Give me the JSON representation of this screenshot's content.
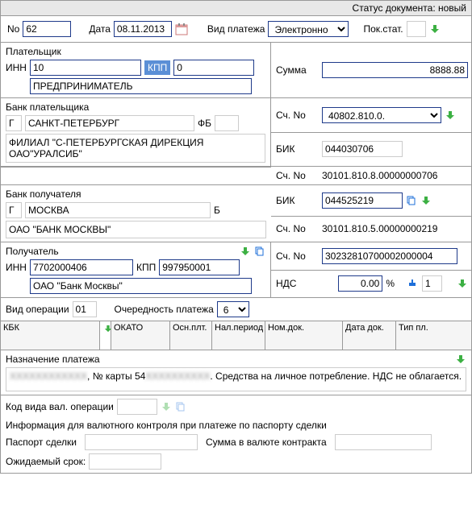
{
  "status_bar": "Статус документа: новый",
  "header": {
    "no_label": "No",
    "no_value": "62",
    "date_label": "Дата",
    "date_value": "08.11.2013",
    "payment_type_label": "Вид платежа",
    "payment_type_value": "Электронно",
    "payment_type_options": [
      "Электронно"
    ],
    "pok_stat_label": "Пок.стат."
  },
  "payer": {
    "title": "Плательщик",
    "inn_label": "ИНН",
    "inn_value": "10",
    "kpp_label": "КПП",
    "kpp_value": "0",
    "name_value": "ПРЕДПРИНИМАТЕЛЬ",
    "bank_title": "Банк плательщика",
    "city_prefix": "Г",
    "city_value": "САНКТ-ПЕТЕРБУРГ",
    "fb_label": "ФБ",
    "bank_name": "ФИЛИАЛ \"С-ПЕТЕРБУРГСКАЯ ДИРЕКЦИЯ ОАО\"УРАЛСИБ\""
  },
  "amount": {
    "label": "Сумма",
    "value": "8888.88"
  },
  "payer_acc": {
    "label": "Сч. No",
    "value": "40802.810.0."
  },
  "payer_bank_bik": {
    "label": "БИК",
    "value": "044030706"
  },
  "payer_bank_acc": {
    "label": "Сч. No",
    "value": "30101.810.8.00000000706"
  },
  "payee_bank": {
    "title": "Банк получателя",
    "city_prefix": "Г",
    "city_value": "МОСКВА",
    "b_label": "Б",
    "bank_name": "ОАО \"БАНК МОСКВЫ\""
  },
  "payee_bank_bik": {
    "label": "БИК",
    "value": "044525219"
  },
  "payee_bank_acc": {
    "label": "Сч. No",
    "value": "30101.810.5.00000000219"
  },
  "payee": {
    "title": "Получатель",
    "inn_label": "ИНН",
    "inn_value": "7702000406",
    "kpp_label": "КПП",
    "kpp_value": "997950001",
    "name_value": "ОАО \"Банк Москвы\""
  },
  "payee_acc": {
    "label": "Сч. No",
    "value": "30232810700002000004"
  },
  "nds": {
    "label": "НДС",
    "percent": "0.00",
    "percent_suffix": "%",
    "code": "1"
  },
  "op": {
    "op_type_label": "Вид операции",
    "op_type_value": "01",
    "priority_label": "Очередность платежа",
    "priority_value": "6"
  },
  "table": {
    "kbk": "КБК",
    "okato": "ОКАТО",
    "osn": "Осн.плт.",
    "period": "Нал.период",
    "nomdok": "Ном.док.",
    "datedok": "Дата док.",
    "type": "Тип пл."
  },
  "purpose": {
    "label": "Назначение платежа",
    "text_prefix": "",
    "text_mid": ", № карты 54",
    "text_suffix": ". Средства на личное потребление. НДС не облагается."
  },
  "currency": {
    "code_label": "Код вида вал. операции",
    "info_label": "Информация для валютного контроля при платеже по паспорту сделки",
    "passport_label": "Паспорт сделки",
    "sum_label": "Сумма в валюте контракта",
    "expected_label": "Ожидаемый срок:"
  }
}
